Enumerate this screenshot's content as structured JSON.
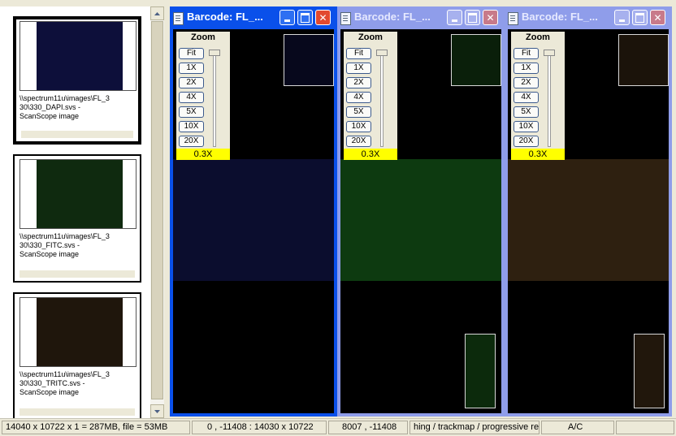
{
  "thumbnails": [
    {
      "caption": "\\\\spectrum11u\\images\\FL_3\n30\\330_DAPI.svs -\nScanScope image",
      "tint": "#0d0f3a",
      "selected": true
    },
    {
      "caption": "\\\\spectrum11u\\images\\FL_3\n30\\330_FITC.svs -\nScanScope image",
      "tint": "#0f2a0f",
      "selected": false
    },
    {
      "caption": "\\\\spectrum11u\\images\\FL_3\n30\\330_TRITC.svs -\nScanScope image",
      "tint": "#1f160c",
      "selected": false
    }
  ],
  "windows": [
    {
      "title": "Barcode: FL_...",
      "active": true,
      "stain": "#1a1f6a"
    },
    {
      "title": "Barcode: FL_...",
      "active": false,
      "stain": "#1f6a1f"
    },
    {
      "title": "Barcode: FL_...",
      "active": false,
      "stain": "#5a3f1a"
    }
  ],
  "zoom": {
    "title": "Zoom",
    "buttons": [
      "Fit",
      "1X",
      "2X",
      "4X",
      "5X",
      "10X",
      "20X"
    ],
    "value": "0.3X"
  },
  "window_controls": {
    "minimize": "_",
    "maximize": "□",
    "close": "✕"
  },
  "statusbar": {
    "image_info": "14040 x 10722 x 1 = 287MB, file = 53MB",
    "view_region": "0 , -11408 : 14030 x 10722",
    "cursor": "8007 , -11408",
    "message": "hing / trackmap / progressive re",
    "mode": "A/C"
  },
  "colors": {
    "accent": "#0a50ea",
    "inactive": "#8f9dea",
    "zoom_value_bg": "#ffff00"
  }
}
